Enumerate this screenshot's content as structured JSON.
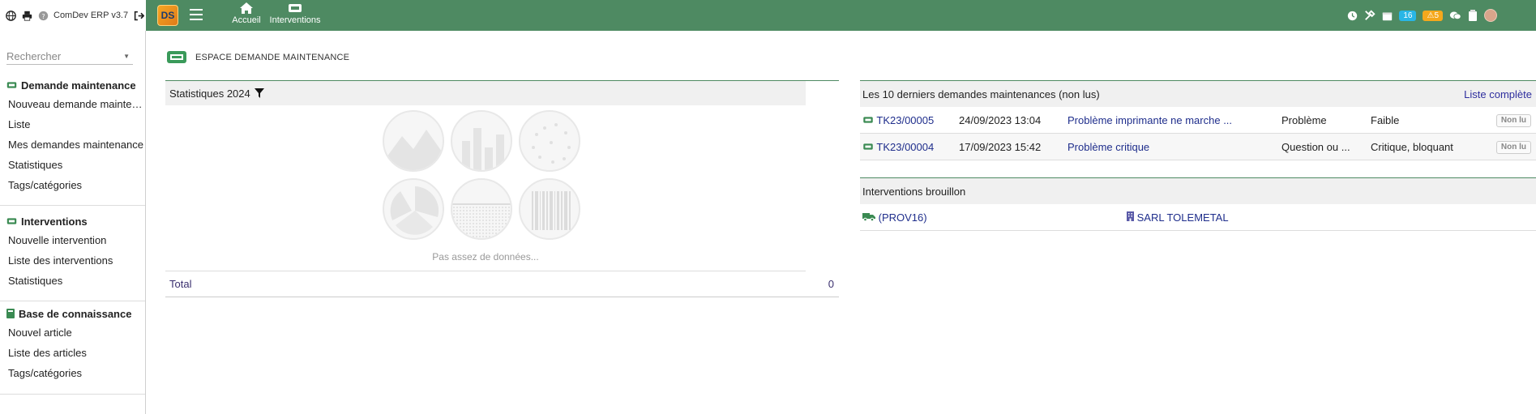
{
  "brand": {
    "name": "ComDev ERP v3.7"
  },
  "topnav": {
    "logo_text": "DS",
    "items": [
      {
        "label": "Accueil",
        "icon": "home-icon"
      },
      {
        "label": "Interventions",
        "icon": "ticket-icon"
      }
    ],
    "right": {
      "badge_blue": "16",
      "badge_orange": "5"
    }
  },
  "sidebar": {
    "search_placeholder": "Rechercher",
    "sections": [
      {
        "title": "Demande maintenance",
        "items": [
          "Nouveau demande maintenance",
          "Liste",
          "Mes demandes maintenance",
          "Statistiques",
          "Tags/catégories"
        ]
      },
      {
        "title": "Interventions",
        "items": [
          "Nouvelle intervention",
          "Liste des interventions",
          "Statistiques"
        ]
      },
      {
        "title": "Base de connaissance",
        "items": [
          "Nouvel article",
          "Liste des articles",
          "Tags/catégories"
        ]
      }
    ]
  },
  "page": {
    "title": "ESPACE DEMANDE MAINTENANCE"
  },
  "stats": {
    "header": "Statistiques 2024",
    "no_data": "Pas assez de données...",
    "total_label": "Total",
    "total_value": "0"
  },
  "latest": {
    "header": "Les 10 derniers demandes maintenances (non lus)",
    "full_list": "Liste complète",
    "rows": [
      {
        "ref": "TK23/00005",
        "date": "24/09/2023 13:04",
        "subject": "Problème imprimante ne marche ...",
        "type": "Problème",
        "severity": "Faible",
        "status": "Non lu"
      },
      {
        "ref": "TK23/00004",
        "date": "17/09/2023 15:42",
        "subject": "Problème critique",
        "type": "Question ou ...",
        "severity": "Critique, bloquant",
        "status": "Non lu"
      }
    ]
  },
  "drafts": {
    "header": "Interventions brouillon",
    "rows": [
      {
        "ref": "(PROV16)",
        "company": "SARL TOLEMETAL"
      }
    ]
  }
}
